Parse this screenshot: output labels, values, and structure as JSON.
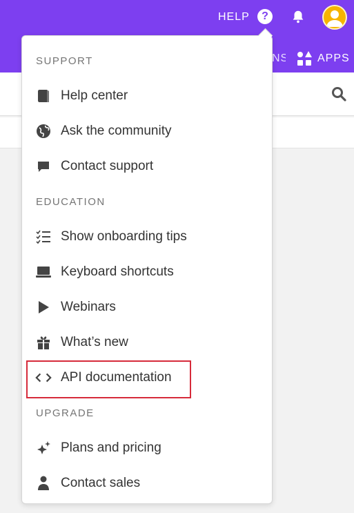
{
  "topbar": {
    "help_label": "HELP",
    "help_icon_glyph": "?",
    "peek_label": "NS",
    "apps_label": "APPS",
    "color": "#7d3ff0"
  },
  "menu": {
    "sections": [
      {
        "label": "SUPPORT"
      },
      {
        "label": "EDUCATION"
      },
      {
        "label": "UPGRADE"
      }
    ],
    "items": [
      {
        "label": "Help center",
        "icon": "book-icon"
      },
      {
        "label": "Ask the community",
        "icon": "globe-icon"
      },
      {
        "label": "Contact support",
        "icon": "chat-bubble-icon"
      },
      {
        "label": "Show onboarding tips",
        "icon": "checklist-icon"
      },
      {
        "label": "Keyboard shortcuts",
        "icon": "laptop-icon"
      },
      {
        "label": "Webinars",
        "icon": "play-icon"
      },
      {
        "label": "What’s new",
        "icon": "gift-icon"
      },
      {
        "label": "API documentation",
        "icon": "code-icon",
        "highlighted": true
      },
      {
        "label": "Plans and pricing",
        "icon": "sparkle-icon"
      },
      {
        "label": "Contact sales",
        "icon": "person-icon"
      }
    ]
  },
  "colors": {
    "highlight": "#d62a3a",
    "icon": "#444444"
  }
}
